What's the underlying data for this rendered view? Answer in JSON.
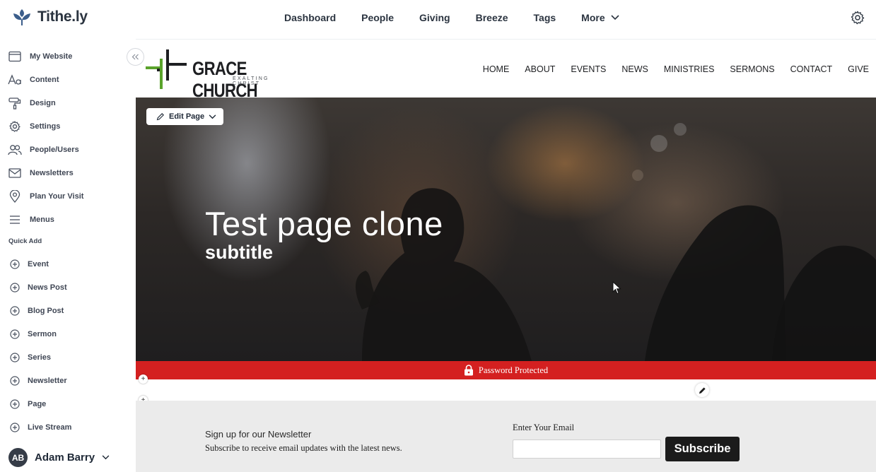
{
  "app": {
    "brand": "Tithe.ly",
    "top_nav": [
      "Dashboard",
      "People",
      "Giving",
      "Breeze",
      "Tags",
      "More"
    ],
    "settings_icon": "gear-icon"
  },
  "sidebar": {
    "items": [
      {
        "label": "My Website",
        "icon": "browser-window-icon"
      },
      {
        "label": "Content",
        "icon": "text-aa-icon"
      },
      {
        "label": "Design",
        "icon": "paint-roller-icon"
      },
      {
        "label": "Settings",
        "icon": "gear-icon"
      },
      {
        "label": "People/Users",
        "icon": "people-icon"
      },
      {
        "label": "Newsletters",
        "icon": "envelope-icon"
      },
      {
        "label": "Plan Your Visit",
        "icon": "map-pin-icon"
      },
      {
        "label": "Menus",
        "icon": "hamburger-menu-icon"
      }
    ],
    "quick_add_heading": "Quick Add",
    "quick_add": [
      "Event",
      "News Post",
      "Blog Post",
      "Sermon",
      "Series",
      "Newsletter",
      "Page",
      "Live Stream"
    ],
    "user": {
      "initials": "AB",
      "name": "Adam Barry"
    }
  },
  "site": {
    "church_name": "GRACE CHURCH",
    "tagline": "EXALTING CHRIST",
    "nav": [
      "HOME",
      "ABOUT",
      "EVENTS",
      "NEWS",
      "MINISTRIES",
      "SERMONS",
      "CONTACT",
      "GIVE"
    ],
    "edit_page_label": "Edit Page",
    "hero_title": "Test page clone",
    "hero_subtitle": "subtitle",
    "password_banner": "Password Protected",
    "newsletter": {
      "heading": "Sign up for our Newsletter",
      "subtext": "Subscribe to receive email updates with the latest news.",
      "email_label": "Enter Your Email",
      "email_value": "",
      "button": "Subscribe"
    }
  },
  "colors": {
    "password_bar": "#d42020",
    "logo_green": "#5aa32b",
    "dark_text": "#2b3440"
  }
}
